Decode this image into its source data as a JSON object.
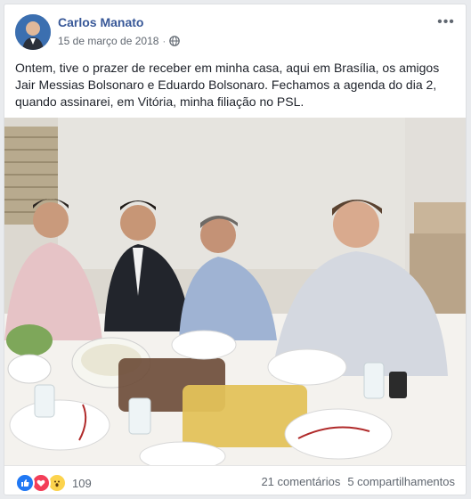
{
  "post": {
    "author": "Carlos Manato",
    "date": "15 de março de 2018",
    "separator": "·",
    "privacy_icon": "globe-icon",
    "more_icon": "ellipsis-icon",
    "more_label": "•••",
    "text": "Ontem, tive o prazer de receber em minha casa, aqui em Brasília, os amigos Jair Messias Bolsonaro e Eduardo Bolsonaro. Fechamos a agenda do dia 2, quando assinarei, em Vitória, minha filiação no PSL."
  },
  "footer": {
    "reaction_icons": [
      "like-icon",
      "love-icon",
      "wow-icon"
    ],
    "reaction_count": "109",
    "comments": "21 comentários",
    "shares": "5 compartilhamentos"
  },
  "colors": {
    "author_link": "#385898",
    "like": "#2078f4",
    "love": "#f33e58",
    "wow": "#fcd34d"
  }
}
